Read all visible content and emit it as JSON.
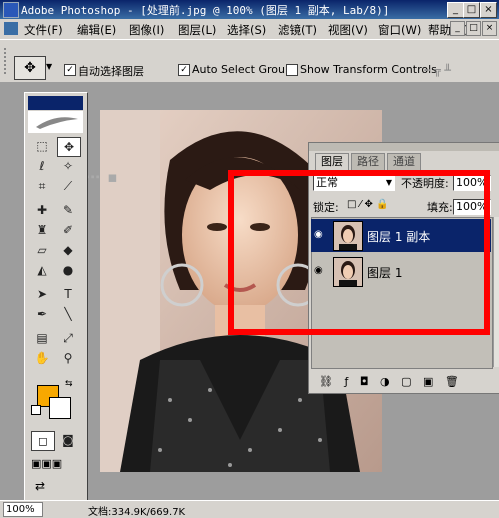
{
  "window": {
    "title": "Adobe Photoshop - [处理前.jpg @ 100% (图层 1 副本, Lab/8)]"
  },
  "menu": [
    "文件(F)",
    "编辑(E)",
    "图像(I)",
    "图层(L)",
    "选择(S)",
    "滤镜(T)",
    "视图(V)",
    "窗口(W)",
    "帮助(H)"
  ],
  "options": {
    "auto_select_layer": "自动选择图层",
    "auto_select_groups": "Auto Select Groups",
    "show_transform_controls": "Show Transform Controls"
  },
  "layers_panel": {
    "tabs": [
      "图层",
      "路径",
      "通道"
    ],
    "blend_mode": "正常",
    "opacity_label": "不透明度:",
    "opacity_value": "100%",
    "lock_label": "锁定:",
    "fill_label": "填充:",
    "fill_value": "100%",
    "layers": [
      {
        "name": "图层 1 副本",
        "selected": true
      },
      {
        "name": "图层 1",
        "selected": false
      }
    ]
  },
  "status": {
    "zoom": "100%",
    "doc_info": "文档:334.9K/669.7K"
  },
  "colors": {
    "foreground": "#f7a800",
    "background": "#ffffff",
    "highlight": "#ff0000",
    "title_bar": "#0a246a"
  },
  "icons": [
    "move-tool-icon",
    "marquee-tool-icon",
    "lasso-tool-icon",
    "magic-wand-icon",
    "crop-tool-icon",
    "brush-tool-icon",
    "eraser-tool-icon",
    "type-tool-icon",
    "pen-tool-icon",
    "hand-tool-icon",
    "zoom-tool-icon",
    "eye-icon",
    "lock-icon"
  ]
}
